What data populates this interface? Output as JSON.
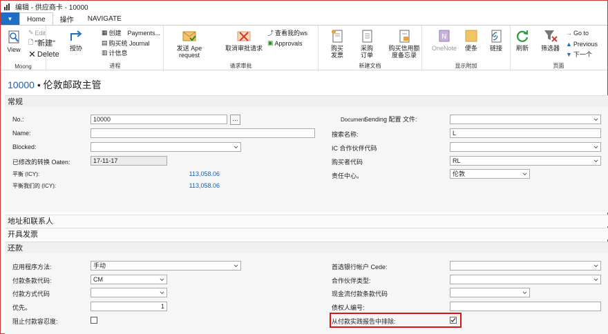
{
  "window": {
    "title": "编辑 - 供应商卡 - 10000"
  },
  "tabs": {
    "file": "▼",
    "home": "Home",
    "actions": "操作",
    "navigate": "NAVIGATE"
  },
  "ribbon": {
    "manage": {
      "view": "View",
      "edit": "Edit",
      "new": "\"新建\"",
      "delete": "Delete",
      "label": "Moong"
    },
    "process": {
      "approvals_btn": "授协",
      "create": "创建",
      "payments": "Payments...",
      "purchase_journal": "购买统 Journal",
      "stats": "计信息",
      "label": "进程"
    },
    "approval": {
      "send": "发送 Ape request",
      "cancel": "取消审批请求",
      "label": "请求审批"
    },
    "approvals2": {
      "view_flows": "查看我的ws",
      "approvals": "Approvals"
    },
    "new_doc": {
      "purchase_invoice": "购买发票",
      "purchase_order": "采购订单",
      "credit_memo": "购买信用额度备忘录",
      "label": "新建文档"
    },
    "show_attached": {
      "onenote": "OneNote",
      "notes": "便条",
      "links": "链接",
      "label": "显示附加"
    },
    "page": {
      "refresh": "刷新",
      "filter": "筛选器",
      "goto": "Go to",
      "previous": "Previous",
      "next": "下一个",
      "label": "页面"
    }
  },
  "header": {
    "number": "10000",
    "name": "• 伦敦邮政主管"
  },
  "general": {
    "title": "常规",
    "no_label": "No.:",
    "no_value": "10000",
    "name_label": "Name:",
    "name_value": "",
    "blocked_label": "Blocked:",
    "blocked_value": "",
    "modified_label": "已修改的转换 Oaten:",
    "modified_value": "17-11-17",
    "balance_label": "平衡 (ICY):",
    "balance_value": "113,058.06",
    "balance_due_label": "平衡我们的 (ICY):",
    "balance_due_value": "113,058.06",
    "doc_sending_label_1": "Document",
    "doc_sending_label_2": "Sending 配置 文件:",
    "doc_sending_value": "",
    "search_label": "搜索名称:",
    "search_value": "L",
    "ic_label": "IC 合作伙伴代码",
    "ic_value": "",
    "purchaser_label": "购买者代码",
    "purchaser_value": "RL",
    "resp_label": "责任中心。",
    "resp_value": "伦敦"
  },
  "sections": {
    "address": "地址和联系人",
    "invoicing": "开具发票",
    "payments": "还款"
  },
  "payments": {
    "app_method_label": "应用程序方法:",
    "app_method_value": "手动",
    "terms_label": "付款条款代码:",
    "terms_value": "CM",
    "method_label": "付款方式代码",
    "method_value": "",
    "priority_label": "优先。",
    "priority_value": "1",
    "block_tol_label": "阻止付款容忍度:",
    "bank_label": "首选银行帐户 Cede:",
    "bank_value": "",
    "partner_type_label": "合作伙伴类型:",
    "partner_type_value": "",
    "cash_flow_label": "现金流付款条款代码",
    "cash_flow_value": "",
    "creditor_label": "债权人编号:",
    "creditor_value": "",
    "exclude_label": "从付款实践报告中排除:"
  },
  "colors": {
    "accent": "#1e6ec4",
    "link": "#1a5fa8",
    "highlight": "#d11111"
  }
}
